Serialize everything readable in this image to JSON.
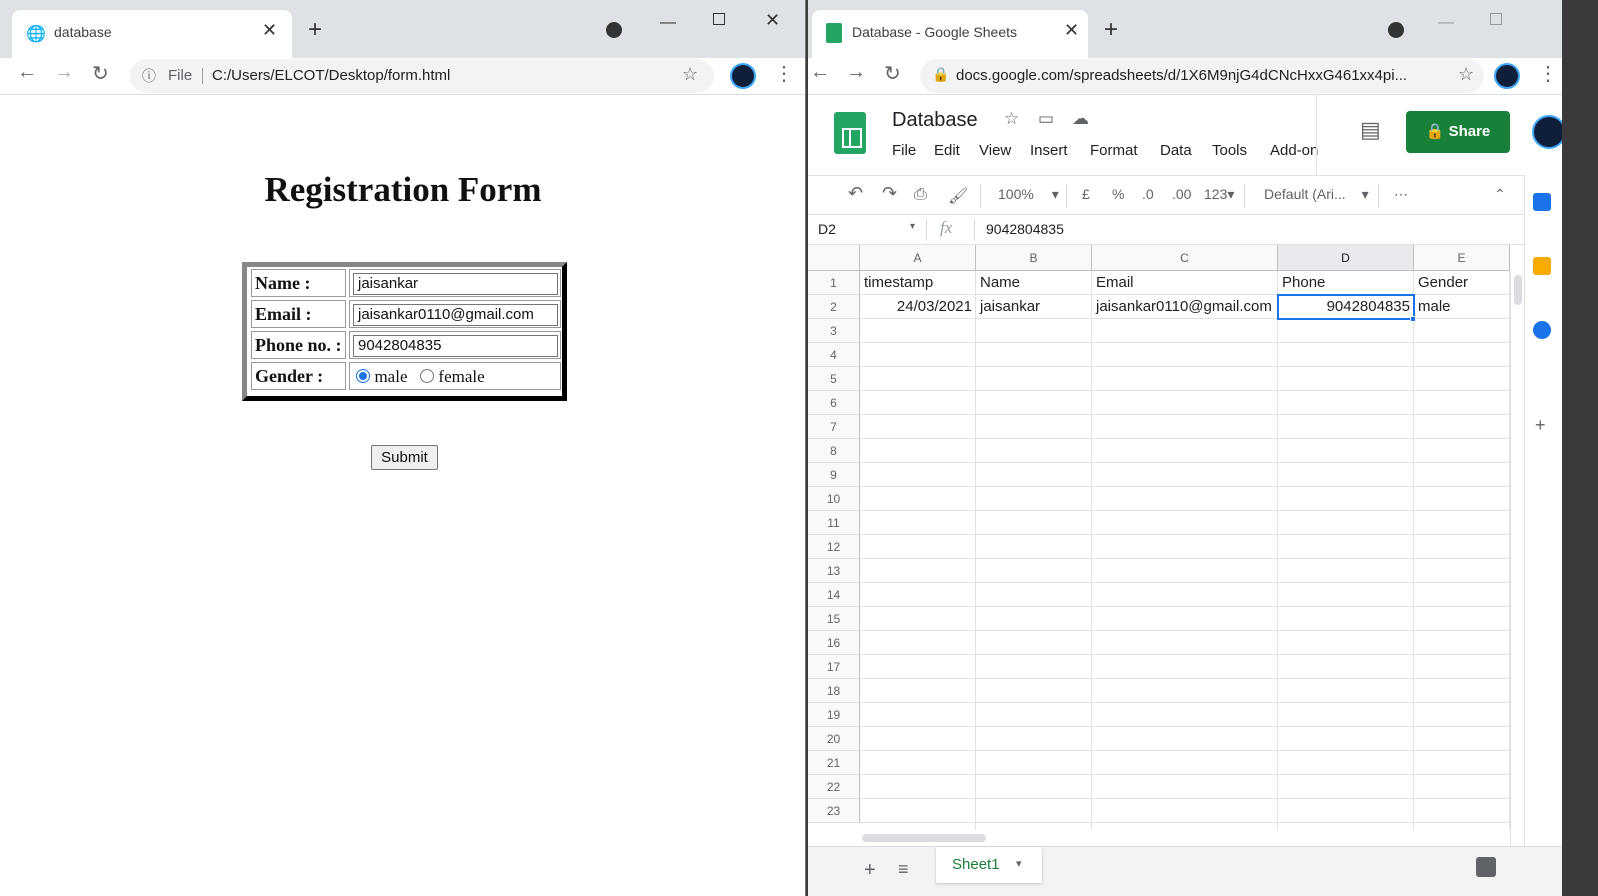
{
  "left_browser": {
    "tab_title": "database",
    "address_prefix": "File",
    "address": "C:/Users/ELCOT/Desktop/form.html",
    "form": {
      "title": "Registration Form",
      "rows": [
        {
          "label": "Name :",
          "value": "jaisankar"
        },
        {
          "label": "Email :",
          "value": "jaisankar0110@gmail.com"
        },
        {
          "label": "Phone no. :",
          "value": "9042804835"
        }
      ],
      "gender_label": "Gender :",
      "gender_options": [
        "male",
        "female"
      ],
      "gender_selected": "male",
      "submit_label": "Submit"
    }
  },
  "right_browser": {
    "tab_title": "Database - Google Sheets",
    "address": "docs.google.com/spreadsheets/d/1X6M9njG4dCNcHxxG461xx4pi...",
    "sheets": {
      "doc_title": "Database",
      "menu": [
        "File",
        "Edit",
        "View",
        "Insert",
        "Format",
        "Data",
        "Tools",
        "Add-on"
      ],
      "share_label": "Share",
      "toolbar": {
        "zoom": "100%",
        "currency": "£",
        "percent": "%",
        "dec_less": ".0",
        "dec_more": ".00",
        "number_format": "123",
        "font": "Default (Ari..."
      },
      "name_box": "D2",
      "formula_value": "9042804835",
      "columns": [
        "A",
        "B",
        "C",
        "D",
        "E"
      ],
      "header_row": [
        "timestamp",
        "Name",
        "Email",
        "Phone",
        "Gender"
      ],
      "data_row": [
        "24/03/2021",
        "jaisankar",
        "jaisankar0110@gmail.com",
        "9042804835",
        "male"
      ],
      "row_numbers": [
        "1",
        "2",
        "3",
        "4",
        "5",
        "6",
        "7",
        "8",
        "9",
        "10",
        "11",
        "12",
        "13",
        "14",
        "15",
        "16",
        "17",
        "18",
        "19",
        "20",
        "21",
        "22",
        "23"
      ],
      "sheet_tab": "Sheet1"
    }
  },
  "colors": {
    "sheets_green": "#188038",
    "selection_blue": "#1a73e8"
  }
}
